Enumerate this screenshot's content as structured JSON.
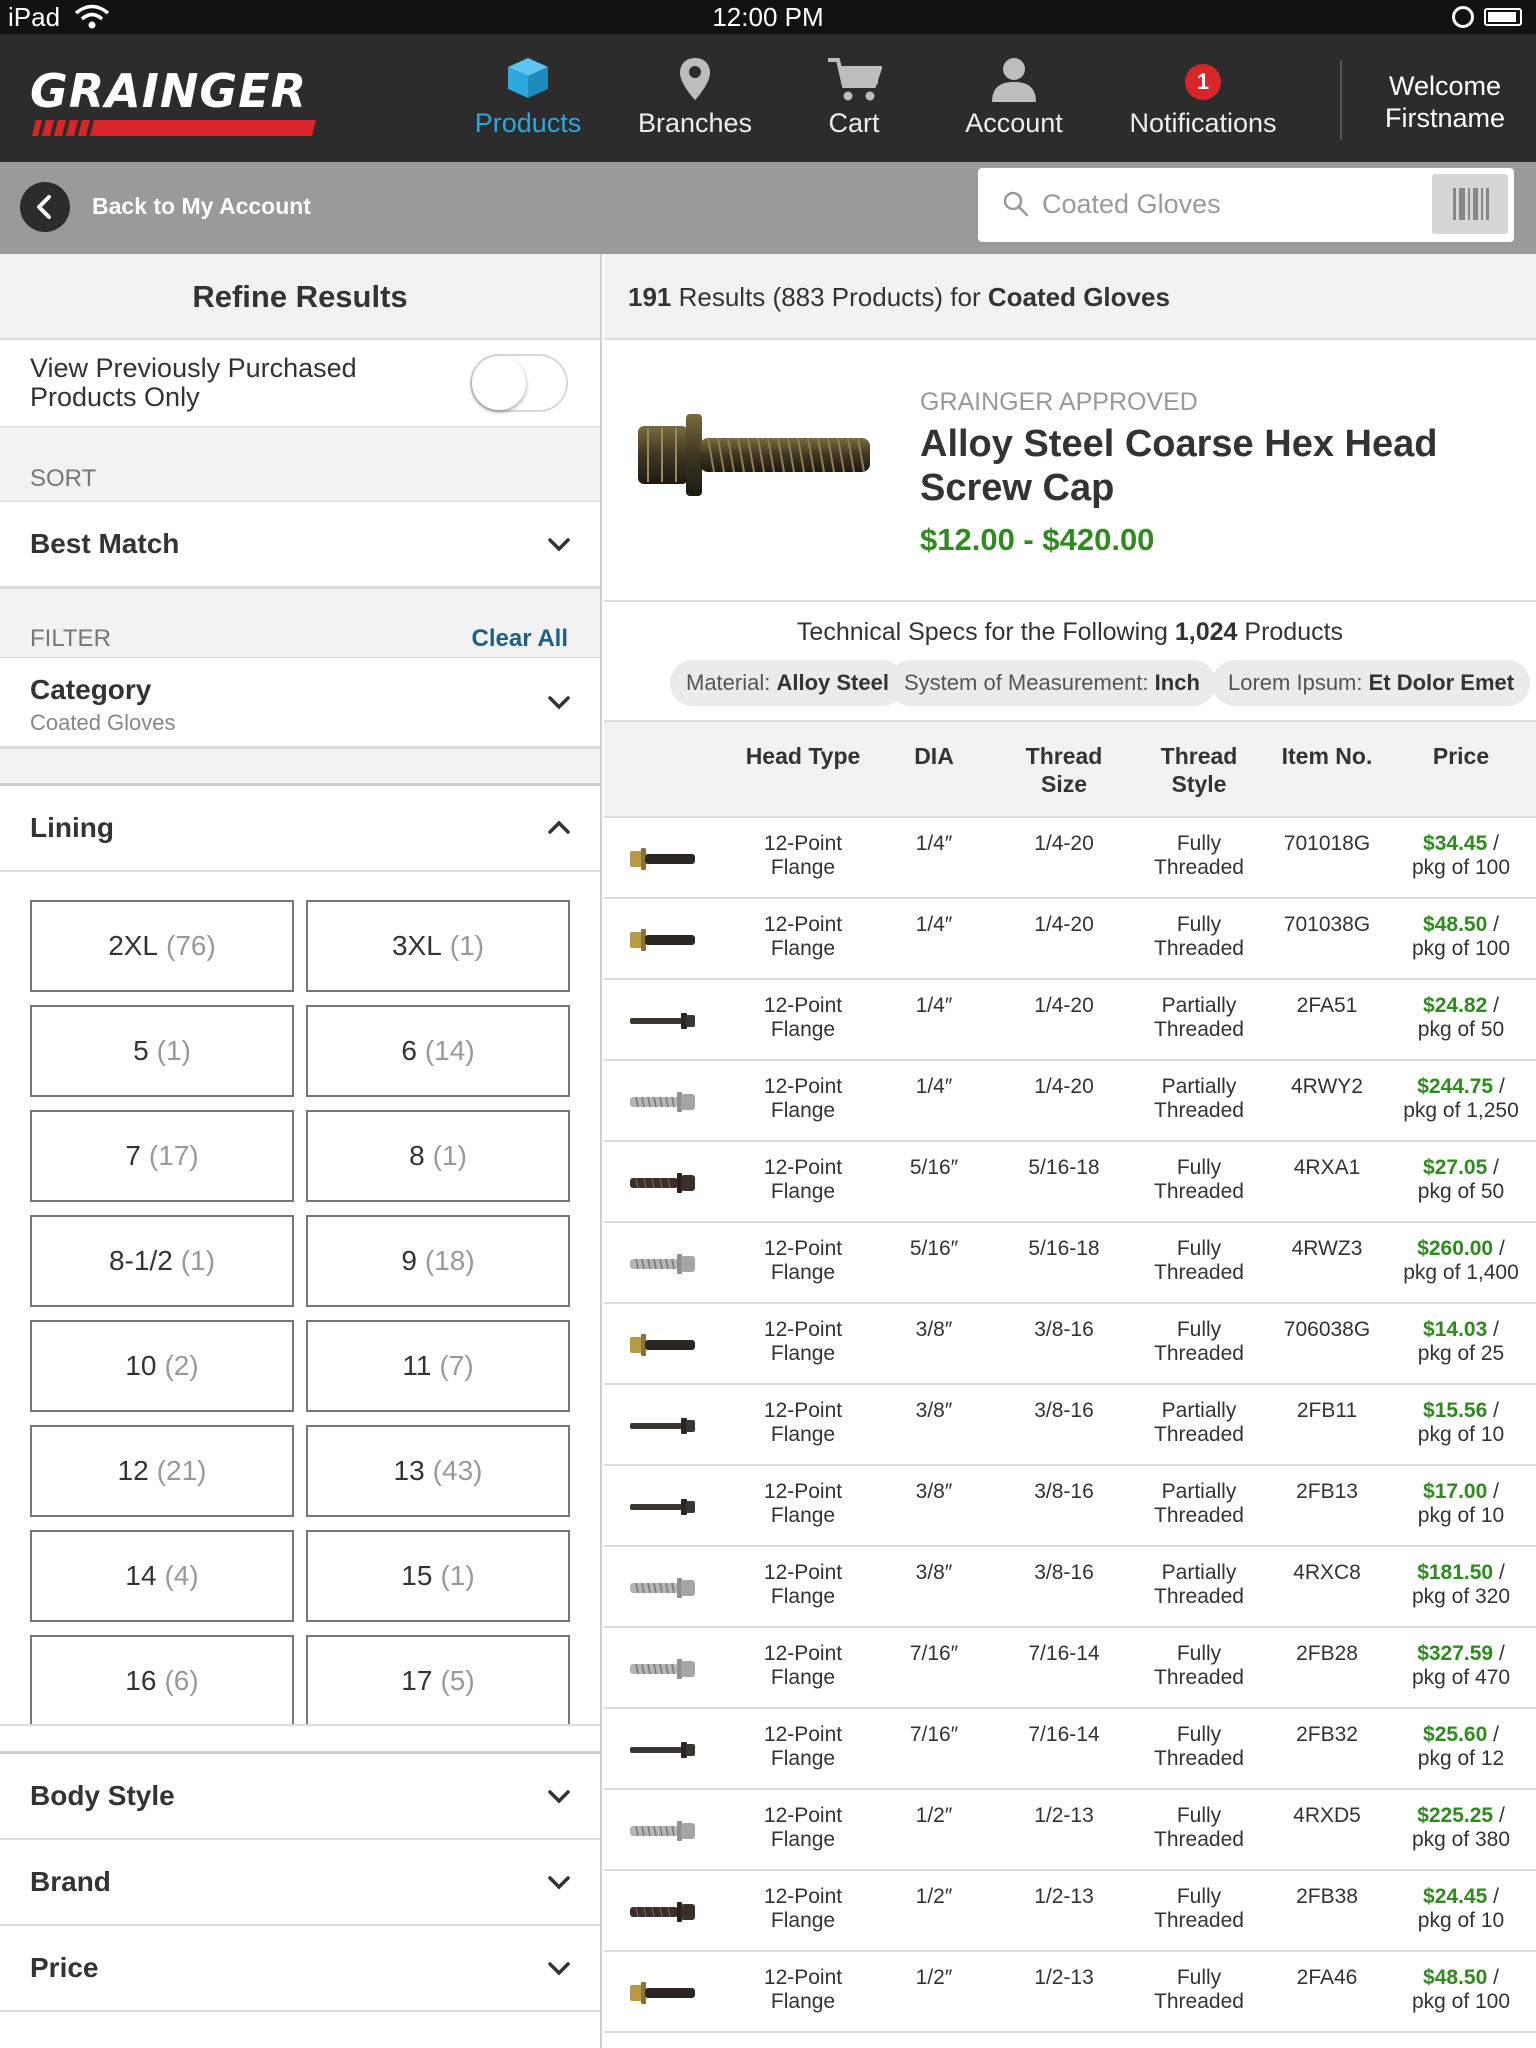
{
  "status_bar": {
    "carrier": "iPad",
    "time": "12:00 PM"
  },
  "header": {
    "logo_text": "GRAINGER",
    "nav": [
      {
        "label": "Products",
        "icon": "box-icon",
        "active": true
      },
      {
        "label": "Branches",
        "icon": "map-pin-icon",
        "active": false
      },
      {
        "label": "Cart",
        "icon": "cart-icon",
        "active": false
      },
      {
        "label": "Account",
        "icon": "person-icon",
        "active": false
      },
      {
        "label": "Notifications",
        "icon": "notification-icon",
        "badge": "1",
        "active": false
      }
    ],
    "welcome_line1": "Welcome",
    "welcome_line2": "Firstname"
  },
  "sub_bar": {
    "back_label": "Back to My Account",
    "search_placeholder": "Coated Gloves"
  },
  "refine": {
    "title": "Refine Results",
    "prev_purchased_label": "View Previously Purchased Products Only",
    "prev_purchased_on": false,
    "sort_label": "SORT",
    "sort_value": "Best Match",
    "filter_label": "FILTER",
    "clear_all": "Clear All",
    "category_title": "Category",
    "category_value": "Coated Gloves",
    "lining_title": "Lining",
    "lining_options": [
      {
        "label": "2XL",
        "count": "(76)"
      },
      {
        "label": "3XL",
        "count": "(1)"
      },
      {
        "label": "5",
        "count": "(1)"
      },
      {
        "label": "6",
        "count": "(14)"
      },
      {
        "label": "7",
        "count": "(17)"
      },
      {
        "label": "8",
        "count": "(1)"
      },
      {
        "label": "8-1/2",
        "count": "(1)"
      },
      {
        "label": "9",
        "count": "(18)"
      },
      {
        "label": "10",
        "count": "(2)"
      },
      {
        "label": "11",
        "count": "(7)"
      },
      {
        "label": "12",
        "count": "(21)"
      },
      {
        "label": "13",
        "count": "(43)"
      },
      {
        "label": "14",
        "count": "(4)"
      },
      {
        "label": "15",
        "count": "(1)"
      },
      {
        "label": "16",
        "count": "(6)"
      },
      {
        "label": "17",
        "count": "(5)"
      }
    ],
    "collapsed_sections": [
      "Body Style",
      "Brand",
      "Price"
    ]
  },
  "results": {
    "count": "191",
    "mid_text": " Results (883 Products) for ",
    "query": "Coated Gloves"
  },
  "product": {
    "approved": "GRAINGER APPROVED",
    "title": "Alloy Steel Coarse Hex Head Screw Cap",
    "price_range": "$12.00 - $420.00"
  },
  "specs": {
    "title_prefix": "Technical Specs for the Following ",
    "title_count": "1,024",
    "title_suffix": " Products",
    "tags": [
      {
        "key": "Material: ",
        "value": "Alloy Steel"
      },
      {
        "key": "System of Measurement: ",
        "value": "Inch"
      },
      {
        "key": "Lorem Ipsum: ",
        "value": "Et Dolor Emet"
      }
    ]
  },
  "table": {
    "headers": [
      "Head Type",
      "DIA",
      "Thread Size",
      "Thread Style",
      "Item No.",
      "Price"
    ],
    "rows": [
      {
        "thumb": "black-gold",
        "head": "12-Point Flange",
        "dia": "1/4″",
        "size": "1/4-20",
        "style": "Fully Threaded",
        "item": "701018G",
        "price": "$34.45",
        "pkg": "pkg of 100"
      },
      {
        "thumb": "black-gold",
        "head": "12-Point Flange",
        "dia": "1/4″",
        "size": "1/4-20",
        "style": "Fully Threaded",
        "item": "701038G",
        "price": "$48.50",
        "pkg": "pkg of 100"
      },
      {
        "thumb": "long-black",
        "head": "12-Point Flange",
        "dia": "1/4″",
        "size": "1/4-20",
        "style": "Partially Threaded",
        "item": "2FA51",
        "price": "$24.82",
        "pkg": "pkg of 50"
      },
      {
        "thumb": "silver",
        "head": "12-Point Flange",
        "dia": "1/4″",
        "size": "1/4-20",
        "style": "Partially Threaded",
        "item": "4RWY2",
        "price": "$244.75",
        "pkg": "pkg of 1,250"
      },
      {
        "thumb": "dark",
        "head": "12-Point Flange",
        "dia": "5/16″",
        "size": "5/16-18",
        "style": "Fully Threaded",
        "item": "4RXA1",
        "price": "$27.05",
        "pkg": "pkg of 50"
      },
      {
        "thumb": "silver",
        "head": "12-Point Flange",
        "dia": "5/16″",
        "size": "5/16-18",
        "style": "Fully Threaded",
        "item": "4RWZ3",
        "price": "$260.00",
        "pkg": "pkg of 1,400"
      },
      {
        "thumb": "black-gold",
        "head": "12-Point Flange",
        "dia": "3/8″",
        "size": "3/8-16",
        "style": "Fully Threaded",
        "item": "706038G",
        "price": "$14.03",
        "pkg": "pkg of 25"
      },
      {
        "thumb": "long-black",
        "head": "12-Point Flange",
        "dia": "3/8″",
        "size": "3/8-16",
        "style": "Partially Threaded",
        "item": "2FB11",
        "price": "$15.56",
        "pkg": "pkg of 10"
      },
      {
        "thumb": "long-black",
        "head": "12-Point Flange",
        "dia": "3/8″",
        "size": "3/8-16",
        "style": "Partially Threaded",
        "item": "2FB13",
        "price": "$17.00",
        "pkg": "pkg of 10"
      },
      {
        "thumb": "silver",
        "head": "12-Point Flange",
        "dia": "3/8″",
        "size": "3/8-16",
        "style": "Partially Threaded",
        "item": "4RXC8",
        "price": "$181.50",
        "pkg": "pkg of 320"
      },
      {
        "thumb": "silver",
        "head": "12-Point Flange",
        "dia": "7/16″",
        "size": "7/16-14",
        "style": "Fully Threaded",
        "item": "2FB28",
        "price": "$327.59",
        "pkg": "pkg of 470"
      },
      {
        "thumb": "long-black",
        "head": "12-Point Flange",
        "dia": "7/16″",
        "size": "7/16-14",
        "style": "Fully Threaded",
        "item": "2FB32",
        "price": "$25.60",
        "pkg": "pkg of 12"
      },
      {
        "thumb": "silver",
        "head": "12-Point Flange",
        "dia": "1/2″",
        "size": "1/2-13",
        "style": "Fully Threaded",
        "item": "4RXD5",
        "price": "$225.25",
        "pkg": "pkg of 380"
      },
      {
        "thumb": "dark",
        "head": "12-Point Flange",
        "dia": "1/2″",
        "size": "1/2-13",
        "style": "Fully Threaded",
        "item": "2FB38",
        "price": "$24.45",
        "pkg": "pkg of 10"
      },
      {
        "thumb": "black-gold",
        "head": "12-Point Flange",
        "dia": "1/2″",
        "size": "1/2-13",
        "style": "Fully Threaded",
        "item": "2FA46",
        "price": "$48.50",
        "pkg": "pkg of 100"
      }
    ]
  },
  "colors": {
    "brand_red": "#d7252a",
    "active_blue": "#29a8dd",
    "price_green": "#2e8b1e",
    "link_blue": "#1e5e8a",
    "nav_bg": "#2c2c2c"
  }
}
